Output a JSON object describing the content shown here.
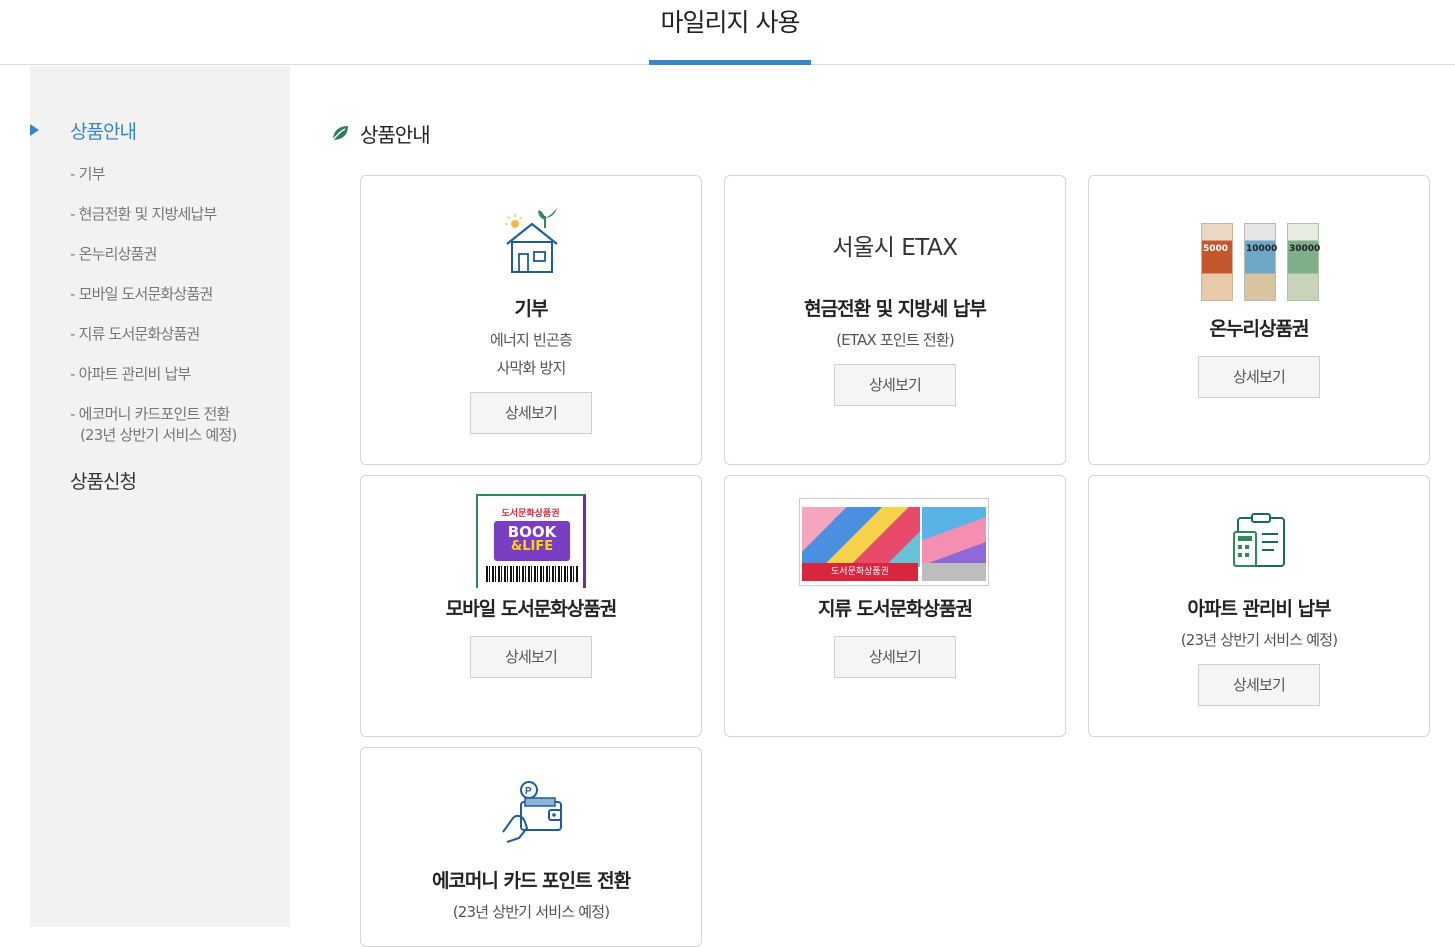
{
  "header": {
    "title": "마일리지 사용"
  },
  "sidebar": {
    "sections": [
      {
        "label": "상품안내",
        "active": true
      },
      {
        "label": "상품신청",
        "active": false
      }
    ],
    "items": [
      {
        "label": "- 기부"
      },
      {
        "label": "- 현금전환 및 지방세납부"
      },
      {
        "label": "- 온누리상품권"
      },
      {
        "label": "- 모바일 도서문화상품권"
      },
      {
        "label": "- 지류 도서문화상품권"
      },
      {
        "label": "- 아파트 관리비 납부"
      },
      {
        "label": "- 에코머니 카드포인트 전환",
        "label2": "(23년 상반기 서비스 예정)"
      }
    ]
  },
  "main": {
    "section_title": "상품안내",
    "cards": [
      {
        "title": "기부",
        "desc1": "에너지 빈곤층",
        "desc2": "사막화 방지",
        "button": "상세보기",
        "icon": "house-plant-icon"
      },
      {
        "logo_text": "서울시 ETAX",
        "title": "현금전환 및 지방세 납부",
        "desc1": "(ETAX 포인트 전환)",
        "button": "상세보기"
      },
      {
        "title": "온누리상품권",
        "button": "상세보기",
        "voucher_values": [
          "5000",
          "10000",
          "30000"
        ]
      },
      {
        "title": "모바일 도서문화상품권",
        "button": "상세보기",
        "card_heading": "도서문화상품권",
        "card_brand1": "BOOK",
        "card_brand2": "&LIFE"
      },
      {
        "title": "지류 도서문화상품권",
        "button": "상세보기",
        "voucher_label": "도서문화상품권"
      },
      {
        "title": "아파트 관리비 납부",
        "desc1": "(23년 상반기 서비스 예정)",
        "button": "상세보기",
        "icon": "calculator-clipboard-icon"
      },
      {
        "title": "에코머니 카드 포인트 전환",
        "desc1": "(23년 상반기 서비스 예정)",
        "icon": "wallet-card-icon"
      }
    ]
  },
  "colors": {
    "accent": "#3a87c8",
    "green": "#2e8b57",
    "sidebar_bg": "#f2f2f2"
  }
}
